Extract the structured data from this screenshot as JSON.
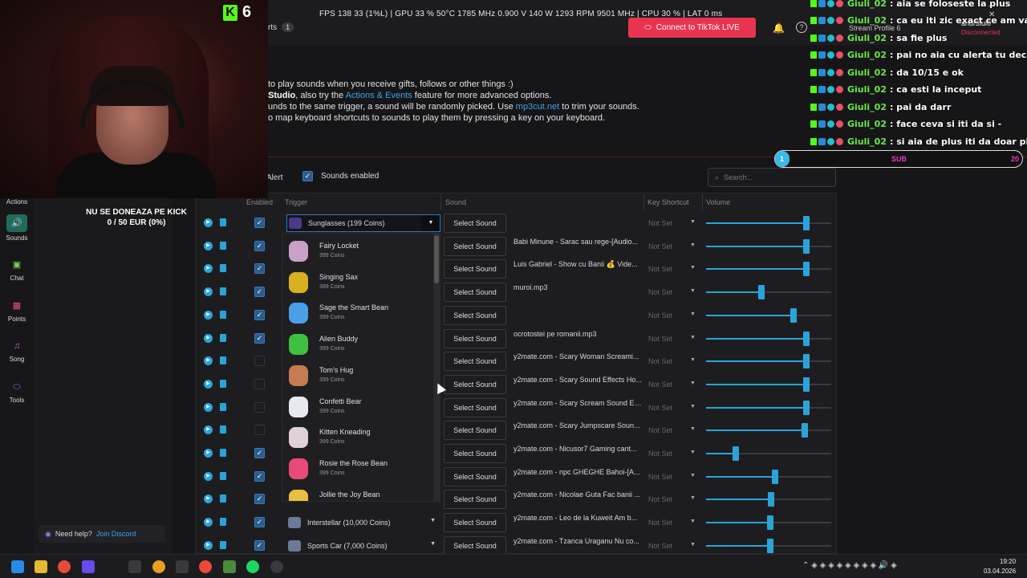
{
  "perf": "FPS 138  33 (1%L)   |   GPU 33 %  50°C  1785 MHz  0.900 V  140 W  1293 RPM  9501 MHz   |   CPU 30 %   |   LAT 0 ms",
  "header": {
    "tab_stub": "rts",
    "tab_badge": "1",
    "connect_button": "Connect to TikTok LIVE",
    "profile": "Stream Profile 6",
    "user": "andr3iul0",
    "user_status": "Disconnected"
  },
  "info": {
    "line1": "to play sounds when you receive gifts, follows or other things :)",
    "line2_bold": "Studio",
    "line2_pre": ", also try the ",
    "line2_link": "Actions & Events",
    "line2_post": " feature for more advanced options.",
    "line3_pre": "unds to the same trigger, a sound will be randomly picked. Use ",
    "line3_link": "mp3cut.net",
    "line3_post": " to trim your sounds.",
    "line4": "o map keyboard shortcuts to sounds to play them by pressing a key on your keyboard."
  },
  "webcam": {
    "kick_count": "6"
  },
  "sidebar": {
    "items": [
      {
        "label": "Actions",
        "icon": "actions-icon"
      },
      {
        "label": "Sounds",
        "icon": "speaker-icon"
      },
      {
        "label": "Chat",
        "icon": "chat-icon"
      },
      {
        "label": "Points",
        "icon": "points-icon"
      },
      {
        "label": "Song",
        "icon": "music-icon"
      },
      {
        "label": "Tools",
        "icon": "tools-icon"
      }
    ]
  },
  "overlay": {
    "donate_line1": "NU SE DONEAZA PE KICK",
    "donate_line2": "0 / 50 EUR (0%)"
  },
  "help": {
    "text": "Need help?",
    "link": "Join Discord"
  },
  "toolbar": {
    "alert_stub": "Alert",
    "sounds_enabled": "Sounds enabled",
    "search_placeholder": "Search..."
  },
  "columns": {
    "enabled": "Enabled",
    "trigger": "Trigger",
    "sound": "Sound",
    "key_shortcut": "Key Shortcut",
    "volume": "Volume"
  },
  "select_sound_label": "Select Sound",
  "not_set_label": "Not Set",
  "rows": [
    {
      "enabled": true,
      "trigger": "Sunglasses (199 Coins)",
      "sound": "",
      "volume": 0.8
    },
    {
      "enabled": true,
      "trigger": "",
      "sound": "Babi Minune - Sarac sau rege-[Audio...",
      "volume": 0.8
    },
    {
      "enabled": true,
      "trigger": "",
      "sound": "Luis Gabriel - Show cu Banii 💰 Vide...",
      "volume": 0.8
    },
    {
      "enabled": true,
      "trigger": "",
      "sound": "muroi.mp3",
      "volume": 0.44
    },
    {
      "enabled": true,
      "trigger": "",
      "sound": "",
      "volume": 0.7
    },
    {
      "enabled": true,
      "trigger": "",
      "sound": "ocrotostei pe romanii.mp3",
      "volume": 0.8
    },
    {
      "enabled": false,
      "trigger": "",
      "sound": "y2mate.com - Scary Woman Screami...",
      "volume": 0.8
    },
    {
      "enabled": false,
      "trigger": "",
      "sound": "y2mate.com - Scary Sound Effects Ho...",
      "volume": 0.8
    },
    {
      "enabled": false,
      "trigger": "",
      "sound": "y2mate.com - Scary Scream Sound Ef...",
      "volume": 0.8
    },
    {
      "enabled": false,
      "trigger": "",
      "sound": "y2mate.com - Scary Jumpscare Soun...",
      "volume": 0.79
    },
    {
      "enabled": true,
      "trigger": "",
      "sound": "y2mate.com - Nicusor7 Gaming cant...",
      "volume": 0.24
    },
    {
      "enabled": true,
      "trigger": "",
      "sound": "y2mate.com - npc GHEGHE Bahoi-[A...",
      "volume": 0.55
    },
    {
      "enabled": true,
      "trigger": "",
      "sound": "y2mate.com - Nicolae Guta Fac banii ...",
      "volume": 0.52
    },
    {
      "enabled": true,
      "trigger": "Interstellar (10,000 Coins)",
      "sound": "y2mate.com - Leo de la Kuweit Am b...",
      "volume": 0.51
    },
    {
      "enabled": true,
      "trigger": "Sports Car (7,000 Coins)",
      "sound": "y2mate.com - Tzanca Uraganu Nu co...",
      "volume": 0.51
    }
  ],
  "dropdown": [
    {
      "name": "Fairy Locket",
      "coins": "399 Coins",
      "color": "#c9a0c8"
    },
    {
      "name": "Singing Sax",
      "coins": "399 Coins",
      "color": "#d8b020"
    },
    {
      "name": "Sage the Smart Bean",
      "coins": "399 Coins",
      "color": "#4aa0e8"
    },
    {
      "name": "Alien Buddy",
      "coins": "399 Coins",
      "color": "#40c040"
    },
    {
      "name": "Tom's Hug",
      "coins": "399 Coins",
      "color": "#c87a50"
    },
    {
      "name": "Confetti Bear",
      "coins": "399 Coins",
      "color": "#e8e8f0"
    },
    {
      "name": "Kitten Kneading",
      "coins": "399 Coins",
      "color": "#e0d0d8"
    },
    {
      "name": "Rosie the Rose Bean",
      "coins": "399 Coins",
      "color": "#e84a78"
    },
    {
      "name": "Jollie the Joy Bean",
      "coins": "399 Coins",
      "color": "#e8c040"
    }
  ],
  "chat": [
    {
      "user": "Giuli_02",
      "msg": ": aia se foloseste la plus"
    },
    {
      "user": "Giuli_02",
      "msg": ": ca eu iti zic exact ce am vazut la"
    },
    {
      "user": "Giuli_02",
      "msg": ": sa fie plus"
    },
    {
      "user": "Giuli_02",
      "msg": ": pai no aia cu alerta tu decizi da"
    },
    {
      "user": "Giuli_02",
      "msg": ": da 10/15 e ok"
    },
    {
      "user": "Giuli_02",
      "msg": ": ca esti la inceput"
    },
    {
      "user": "Giuli_02",
      "msg": ": pai da darr"
    },
    {
      "user": "Giuli_02",
      "msg": ": face ceva si iti da si -"
    },
    {
      "user": "Giuli_02",
      "msg": ": si aia de plus iti da doar plus"
    }
  ],
  "sub_bar": {
    "left": "1",
    "mid": "SUB",
    "right": "20",
    "progress": 0.05
  },
  "taskbar": {
    "time": "19:20",
    "date": "03.04.2026"
  },
  "colors": {
    "accent": "#2aa4d8",
    "tiktok": "#e8344f",
    "kick": "#53fc18",
    "chat_user": "#6be84a"
  }
}
